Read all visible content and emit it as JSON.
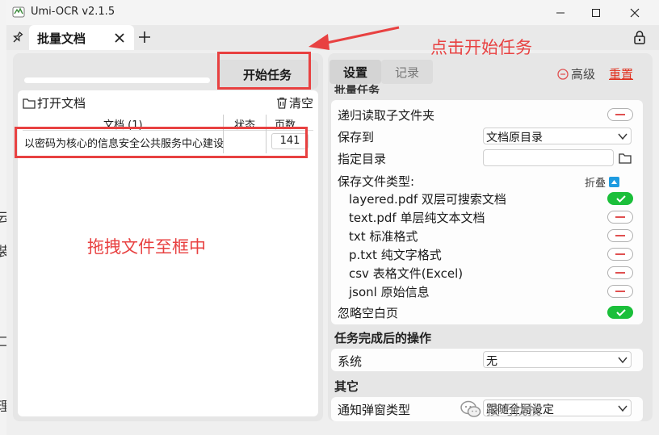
{
  "window": {
    "title": "Umi-OCR v2.1.5"
  },
  "tabs": [
    {
      "label": "批量文档"
    }
  ],
  "left": {
    "start_button": "开始任务",
    "progress": 0,
    "open_doc": "打开文档",
    "clear": "清空",
    "table": {
      "headers": [
        "文档 (1)",
        "状态",
        "页数"
      ],
      "rows": [
        {
          "doc": "以密码为核心的信息安全公共服务中心建设",
          "status": "",
          "pages": "141"
        }
      ]
    }
  },
  "right": {
    "tab_settings": "设置",
    "tab_records": "记录",
    "advanced": "高级",
    "reset": "重置",
    "section_batch": "批量任务",
    "recursive": "递归读取子文件夹",
    "save_to_label": "保存到",
    "save_to_value": "文档原目录",
    "dir_label": "指定目录",
    "dir_value": "",
    "filetype_label": "保存文件类型:",
    "fold": "折叠",
    "types": [
      {
        "label": "layered.pdf 双层可搜索文档",
        "on": true
      },
      {
        "label": "text.pdf 单层纯文本文档",
        "on": false
      },
      {
        "label": "txt 标准格式",
        "on": false
      },
      {
        "label": "p.txt 纯文字格式",
        "on": false
      },
      {
        "label": "csv 表格文件(Excel)",
        "on": false
      },
      {
        "label": "jsonl 原始信息",
        "on": false
      }
    ],
    "ignore_blank": "忽略空白页",
    "ignore_blank_on": true,
    "after_task_title": "任务完成后的操作",
    "system_label": "系统",
    "system_value": "无",
    "other_title": "其它",
    "notify_label": "通知弹窗类型",
    "notify_value": "跟随全局设定"
  },
  "annotations": {
    "click_start": "点击开始任务",
    "drag_file": "拖拽文件至框中"
  },
  "desktop_glyphs": [
    "云",
    "装",
    "口",
    "理"
  ],
  "watermark": "技巧找找",
  "colors": {
    "accent_red": "#e84141",
    "toggle_on": "#1bbf3a",
    "reset": "#e0301e"
  }
}
